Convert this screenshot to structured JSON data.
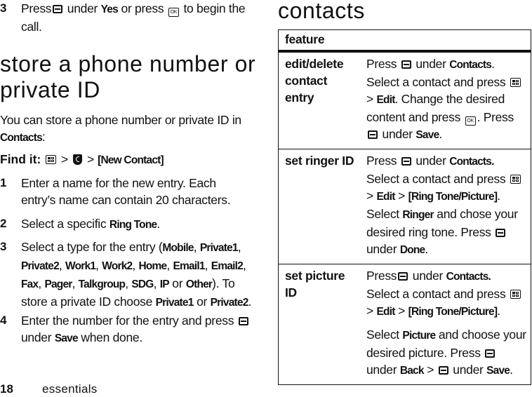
{
  "left": {
    "step3_prev": {
      "num": "3",
      "t1": "Press",
      "t2": " under ",
      "k1": "Yes",
      "t3": " or press ",
      "t4": " to begin the call."
    },
    "heading": "store a phone number or private ID",
    "intro": {
      "t1": "You can store a phone number or private ID in ",
      "k1": "Contacts",
      "t2": ":"
    },
    "find_it": {
      "label": "Find it:",
      "sep1": " > ",
      "sep2": " > ",
      "target": "[New Contact]",
      "icons": [
        "menu-key-icon",
        "contacts-icon"
      ]
    },
    "steps": [
      {
        "num": "1",
        "text": "Enter a name for the new entry. Each entry’s name can contain 20 characters."
      },
      {
        "num": "2",
        "t1": "Select a specific ",
        "k1": "Ring Tone",
        "t2": "."
      },
      {
        "num": "3",
        "t1": "Select a type for the entry (",
        "types": [
          "Mobile",
          "Private1",
          "Private2",
          "Work1",
          "Work2",
          "Home",
          "Email1",
          "Email2",
          "Fax",
          "Pager",
          "Talkgroup",
          "SDG",
          "IP"
        ],
        "t_or": " or ",
        "k_last": "Other",
        "t2": "). To store a private ID choose ",
        "k2": "Private1",
        "t3": " or ",
        "k3": "Private2",
        "t4": "."
      },
      {
        "num": "4",
        "t1": "Enter the number for the entry and press ",
        "t2": " under ",
        "k1": "Save",
        "t3": " when done."
      }
    ]
  },
  "right": {
    "heading": "contacts",
    "table": {
      "header": "feature",
      "rows": [
        {
          "feature": "edit/delete contact entry",
          "desc": {
            "a": "Press ",
            "b": " under ",
            "k1": "Contacts",
            "c": ". Select a contact and press ",
            "d": " > ",
            "k2": "Edit",
            "e": ". Change the desired content and press ",
            "f": ". Press ",
            "g": " under ",
            "k3": "Save",
            "h": "."
          }
        },
        {
          "feature": "set ringer ID",
          "desc": {
            "a": "Press ",
            "b": " under ",
            "k1": "Contacts.",
            "c": " Select a contact and press ",
            "d": " > ",
            "k2": "Edit",
            "e": " > ",
            "k3": "[Ring Tone/Picture]",
            "f": ". Select ",
            "k4": "Ringer",
            "g": " and chose your desired ring tone. Press ",
            "h": " under ",
            "k5": "Done",
            "i": "."
          }
        },
        {
          "feature": "set picture ID",
          "desc": {
            "a": "Press",
            "b": " under ",
            "k1": "Contacts.",
            "c": " Select a contact and press ",
            "d": " > ",
            "k2": "Edit",
            "e": " > ",
            "k3": "[Ring Tone/Picture]",
            "f": ".",
            "p2a": "Select ",
            "k4": "Picture",
            "p2b": " and choose your desired picture. Press ",
            "p2c": " under ",
            "k5": "Back",
            "p2d": " > ",
            "p2e": " under ",
            "k6": "Save",
            "p2f": "."
          }
        }
      ]
    }
  },
  "footer": {
    "page_number": "18",
    "section": "essentials"
  }
}
